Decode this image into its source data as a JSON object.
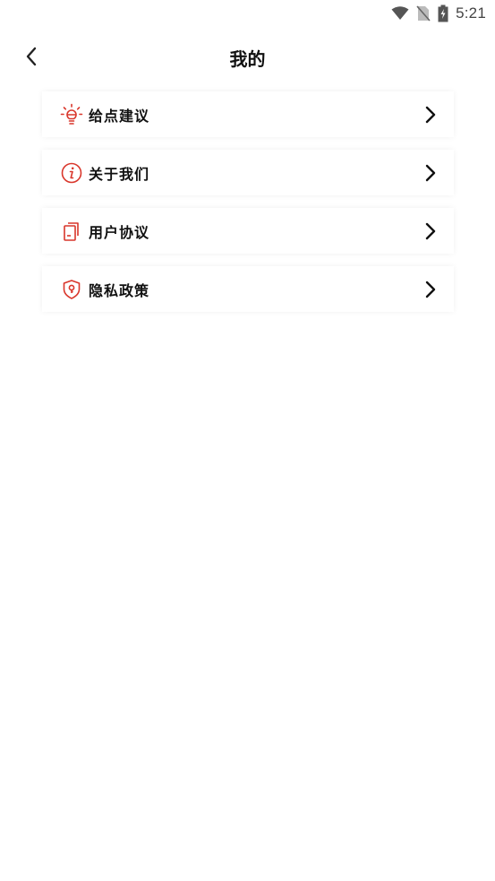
{
  "status_bar": {
    "time": "5:21",
    "icons": [
      "wifi-icon",
      "no-sim-icon",
      "battery-charging-icon"
    ]
  },
  "header": {
    "title": "我的",
    "back_icon": "chevron-left-icon"
  },
  "menu": {
    "items": [
      {
        "label": "给点建议",
        "icon": "lightbulb-icon"
      },
      {
        "label": "关于我们",
        "icon": "info-icon"
      },
      {
        "label": "用户协议",
        "icon": "document-icon"
      },
      {
        "label": "隐私政策",
        "icon": "shield-icon"
      }
    ]
  },
  "colors": {
    "accent": "#d9362b",
    "text": "#111111",
    "background": "#ffffff"
  }
}
